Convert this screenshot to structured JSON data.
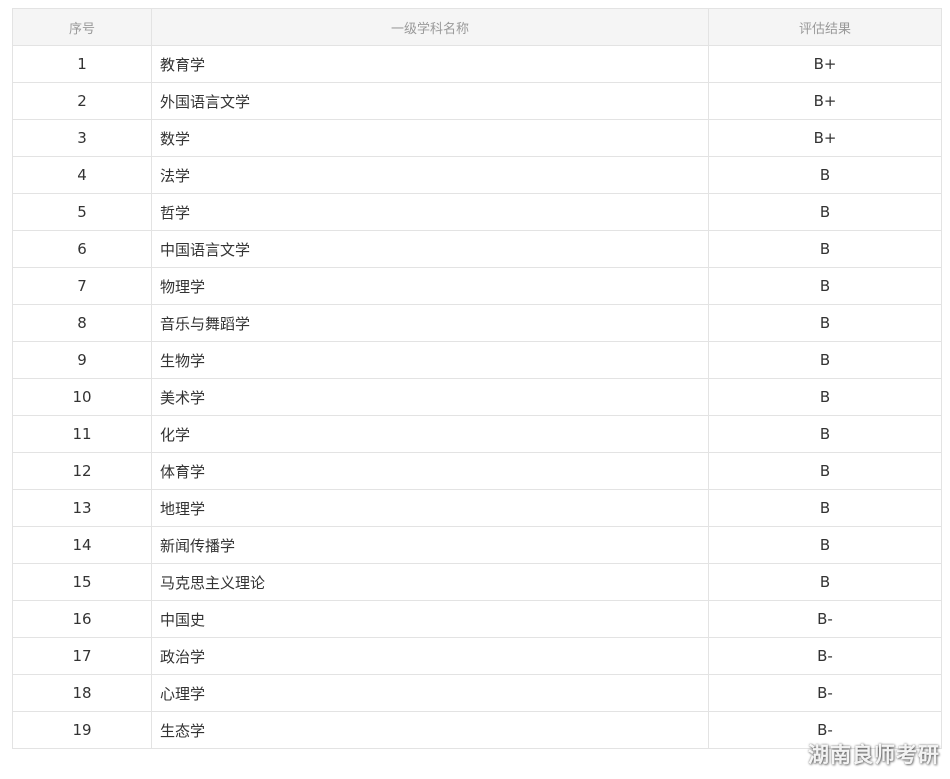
{
  "table": {
    "headers": [
      "序号",
      "一级学科名称",
      "评估结果"
    ],
    "rows": [
      {
        "no": "1",
        "name": "教育学",
        "result": "B+"
      },
      {
        "no": "2",
        "name": "外国语言文学",
        "result": "B+"
      },
      {
        "no": "3",
        "name": "数学",
        "result": "B+"
      },
      {
        "no": "4",
        "name": "法学",
        "result": "B"
      },
      {
        "no": "5",
        "name": "哲学",
        "result": "B"
      },
      {
        "no": "6",
        "name": "中国语言文学",
        "result": "B"
      },
      {
        "no": "7",
        "name": "物理学",
        "result": "B"
      },
      {
        "no": "8",
        "name": "音乐与舞蹈学",
        "result": "B"
      },
      {
        "no": "9",
        "name": "生物学",
        "result": "B"
      },
      {
        "no": "10",
        "name": "美术学",
        "result": "B"
      },
      {
        "no": "11",
        "name": "化学",
        "result": "B"
      },
      {
        "no": "12",
        "name": "体育学",
        "result": "B"
      },
      {
        "no": "13",
        "name": "地理学",
        "result": "B"
      },
      {
        "no": "14",
        "name": "新闻传播学",
        "result": "B"
      },
      {
        "no": "15",
        "name": "马克思主义理论",
        "result": "B"
      },
      {
        "no": "16",
        "name": "中国史",
        "result": "B-"
      },
      {
        "no": "17",
        "name": "政治学",
        "result": "B-"
      },
      {
        "no": "18",
        "name": "心理学",
        "result": "B-"
      },
      {
        "no": "19",
        "name": "生态学",
        "result": "B-"
      }
    ]
  },
  "watermark": "湖南良师考研",
  "colors": {
    "header_bg": "#f5f5f5",
    "border": "#e3e3e3",
    "header_text": "#999999",
    "body_text": "#333333"
  }
}
